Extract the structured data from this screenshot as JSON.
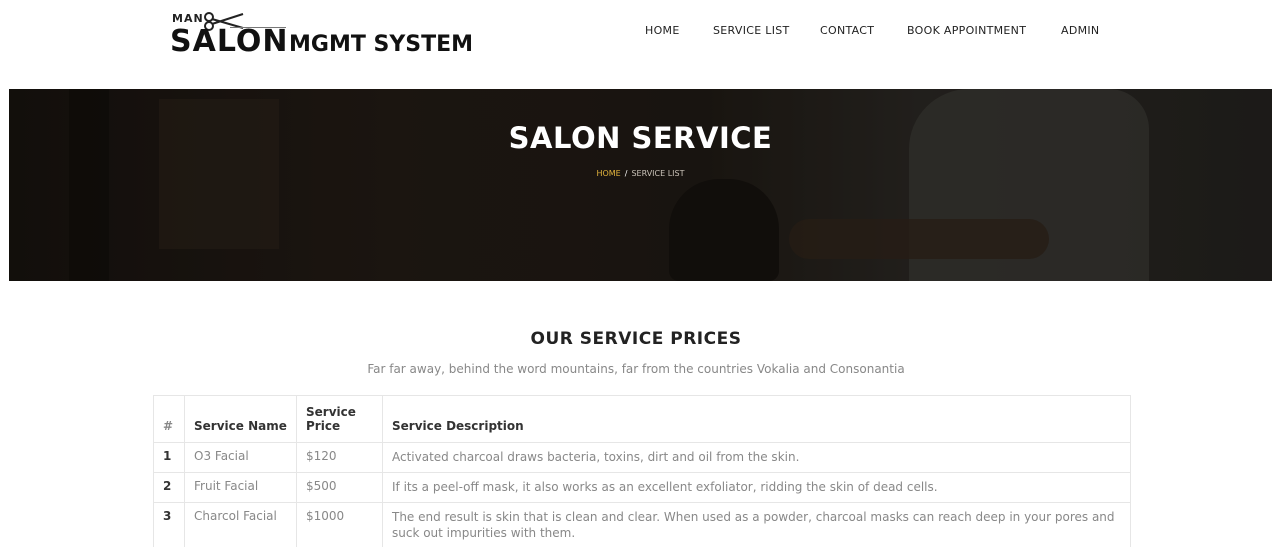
{
  "brand": {
    "man": "MAN",
    "salon": "SALON",
    "mgmt": "MGMT SYSTEM"
  },
  "nav": {
    "items": [
      {
        "label": "HOME"
      },
      {
        "label": "SERVICE LIST"
      },
      {
        "label": "CONTACT"
      },
      {
        "label": "BOOK APPOINTMENT"
      },
      {
        "label": "ADMIN"
      }
    ]
  },
  "hero": {
    "title": "SALON SERVICE",
    "crumb_home": "HOME",
    "crumb_sep": "/",
    "crumb_current": "SERVICE LIST"
  },
  "section": {
    "title": "OUR SERVICE PRICES",
    "subtitle": "Far far away, behind the word mountains, far from the countries Vokalia and Consonantia"
  },
  "table": {
    "headers": {
      "num": "#",
      "name": "Service Name",
      "price": "Service Price",
      "desc": "Service Description"
    },
    "rows": [
      {
        "num": "1",
        "name": "O3 Facial",
        "price": "$120",
        "desc": "Activated charcoal draws bacteria, toxins, dirt and oil from the skin."
      },
      {
        "num": "2",
        "name": "Fruit Facial",
        "price": "$500",
        "desc": "If its a peel-off mask, it also works as an excellent exfoliator, ridding the skin of dead cells."
      },
      {
        "num": "3",
        "name": "Charcol Facial",
        "price": "$1000",
        "desc": "The end result is skin that is clean and clear. When used as a powder, charcoal masks can reach deep in your pores and suck out impurities with them."
      }
    ]
  }
}
